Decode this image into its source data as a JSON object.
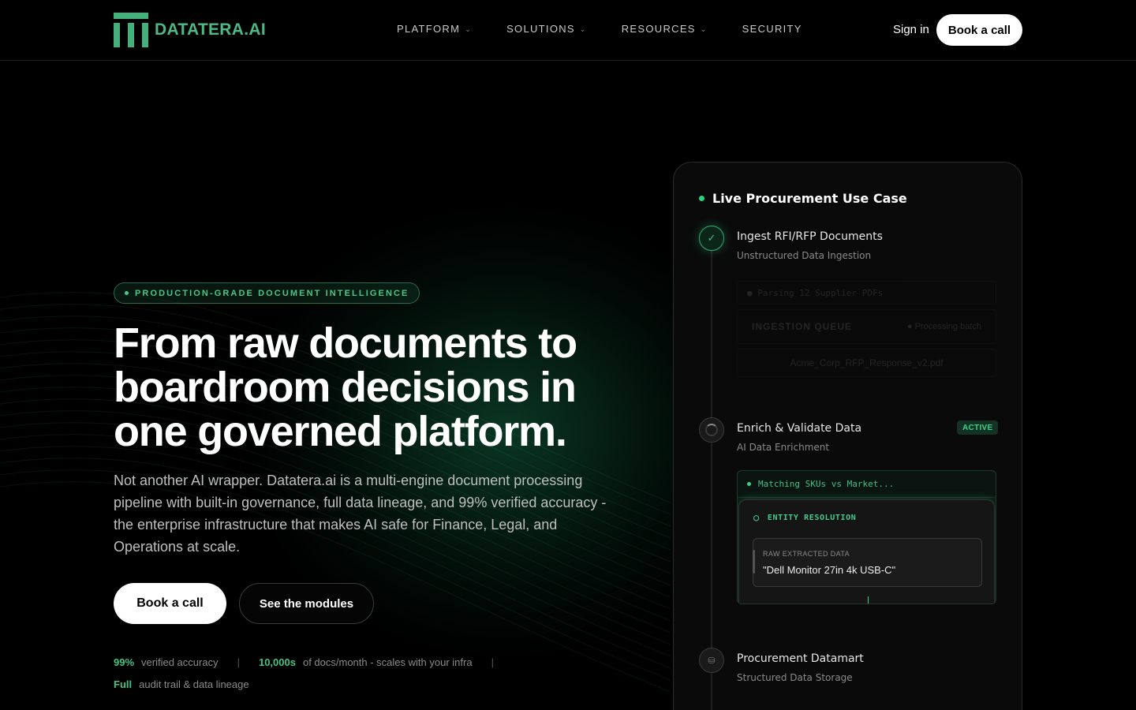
{
  "header": {
    "logo_text": "DATATERA.AI",
    "nav": [
      {
        "label": "PLATFORM",
        "has_dropdown": true
      },
      {
        "label": "SOLUTIONS",
        "has_dropdown": true
      },
      {
        "label": "RESOURCES",
        "has_dropdown": true
      },
      {
        "label": "SECURITY",
        "has_dropdown": false
      }
    ],
    "signin_label": "Sign in",
    "book_label": "Book a call"
  },
  "hero": {
    "tag": "PRODUCTION-GRADE DOCUMENT INTELLIGENCE",
    "headline": "From raw documents to boardroom decisions in one governed platform.",
    "subtext": "Not another AI wrapper. Datatera.ai is a multi-engine document processing pipeline with built-in governance, full data lineage, and 99% verified accuracy - the enterprise infrastructure that makes AI safe for Finance, Legal, and Operations at scale.",
    "primary_cta": "Book a call",
    "secondary_cta": "See the modules",
    "stats": [
      {
        "value": "99%",
        "label": "verified accuracy"
      },
      {
        "value": "10,000s",
        "label": "of docs/month - scales with your infra"
      },
      {
        "value": "Full",
        "label": "audit trail & data lineage"
      }
    ]
  },
  "usecase": {
    "title": "Live Procurement Use Case",
    "steps": [
      {
        "title": "Ingest RFI/RFP Documents",
        "subtitle": "Unstructured Data Ingestion",
        "status": "done"
      },
      {
        "title": "Enrich & Validate Data",
        "subtitle": "AI Data Enrichment",
        "status": "active",
        "badge": "ACTIVE"
      },
      {
        "title": "Procurement Datamart",
        "subtitle": "Structured Data Storage",
        "status": "pending"
      }
    ],
    "ingest_preview": {
      "log": "● Parsing 12 Supplier PDFs",
      "queue_label": "INGESTION QUEUE",
      "queue_status": "● Processing batch",
      "file": "Acme_Corp_RFP_Response_v2.pdf"
    },
    "enrich_preview": {
      "log": "Matching SKUs vs Market...",
      "panel_title": "ENTITY RESOLUTION",
      "raw_label": "RAW EXTRACTED DATA",
      "raw_value": "\"Dell Monitor 27in 4k USB-C\""
    }
  },
  "colors": {
    "accent": "#46c285",
    "background": "#000000",
    "card": "#0a0a0a"
  }
}
